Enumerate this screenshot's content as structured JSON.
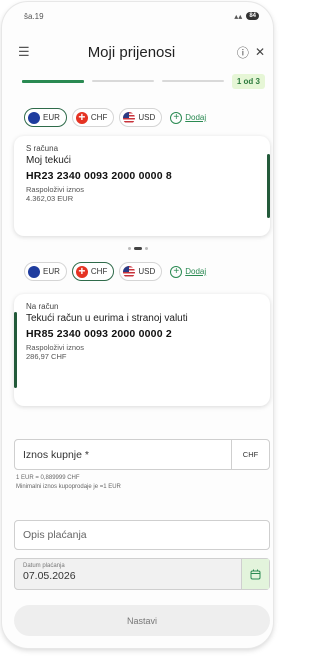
{
  "status_bar": {
    "time": "ŝa.19",
    "battery": "84"
  },
  "header": {
    "title": "Moji prijenosi",
    "info_icon": "info-icon",
    "close_icon": "close-icon",
    "menu_icon": "menu-icon"
  },
  "progress": {
    "current_step": 1,
    "total_steps": 3,
    "label": "1 od 3"
  },
  "colors": {
    "accent": "#2a8a52",
    "dark_green": "#235a3a",
    "badge_bg": "#e6f6d6"
  },
  "chips_top": {
    "items": [
      {
        "code": "EUR",
        "icon": "eu-flag-icon"
      },
      {
        "code": "CHF",
        "icon": "swiss-flag-icon"
      },
      {
        "code": "USD",
        "icon": "us-flag-icon"
      }
    ],
    "selected": "EUR",
    "add_label": "Dodaj"
  },
  "from_account": {
    "heading": "S računa",
    "name": "Moj tekući",
    "iban": "HR23 2340 0093 2000 0000 8",
    "balance_label": "Raspoloživi iznos",
    "balance": "4.362,03 EUR"
  },
  "chips_bottom": {
    "items": [
      {
        "code": "EUR",
        "icon": "eu-flag-icon"
      },
      {
        "code": "CHF",
        "icon": "swiss-flag-icon"
      },
      {
        "code": "USD",
        "icon": "us-flag-icon"
      }
    ],
    "selected": "CHF",
    "add_label": "Dodaj"
  },
  "to_account": {
    "heading": "Na račun",
    "name": "Tekući račun u eurima i stranoj valuti",
    "iban": "HR85 2340 0093 2000 0000 2",
    "balance_label": "Raspoloživi iznos",
    "balance": "286,97 CHF"
  },
  "amount": {
    "label": "Iznos kupnje *",
    "currency": "CHF"
  },
  "rate": {
    "line1": "1 EUR = 0,889999 CHF",
    "line2": "Minimalni iznos kupoprodaje je =1 EUR"
  },
  "description": {
    "placeholder": "Opis plaćanja"
  },
  "date": {
    "label": "Datum plaćanja",
    "value": "07.05.2026",
    "icon": "calendar-icon"
  },
  "submit": {
    "label": "Nastavi"
  }
}
